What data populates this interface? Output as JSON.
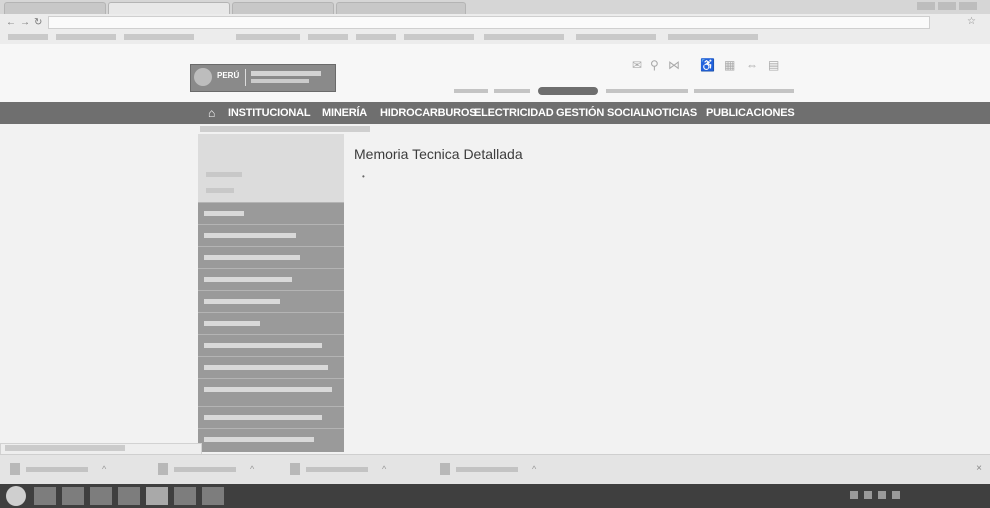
{
  "browser": {
    "tabs": [
      {
        "label": ""
      },
      {
        "label": ""
      },
      {
        "label": ""
      },
      {
        "label": ""
      }
    ],
    "url": "",
    "bookmarks": [
      "",
      "",
      "",
      "",
      "",
      "",
      "",
      "",
      "",
      ""
    ]
  },
  "site": {
    "logo": {
      "country": "PERÚ",
      "name": ""
    },
    "utility_links": [
      "",
      "",
      "",
      ""
    ],
    "utility_pill": "",
    "header_icons": [
      "mail-icon",
      "search-icon",
      "share-icon",
      "accessibility-icon",
      "grid-icon",
      "link-icon",
      "card-icon"
    ]
  },
  "nav": {
    "home_icon": "home-icon",
    "items": [
      {
        "label": "INSTITUCIONAL"
      },
      {
        "label": "MINERÍA"
      },
      {
        "label": "HIDROCARBUROS"
      },
      {
        "label": "ELECTRICIDAD"
      },
      {
        "label": "GESTIÓN SOCIAL"
      },
      {
        "label": "NOTICIAS"
      },
      {
        "label": "PUBLICACIONES"
      }
    ]
  },
  "sidebar": {
    "breadcrumb": "",
    "top_links": [
      "",
      ""
    ],
    "menu_items": [
      "",
      "",
      "",
      "",
      "",
      "",
      "",
      "",
      "",
      "",
      ""
    ]
  },
  "content": {
    "title": "Memoria Tecnica Detallada",
    "doc_link": ""
  },
  "status_bar": {
    "text": ""
  },
  "downloads": {
    "items": [
      {
        "name": ""
      },
      {
        "name": ""
      },
      {
        "name": ""
      },
      {
        "name": ""
      }
    ],
    "show_all": "",
    "close": "×"
  },
  "taskbar": {
    "time": "",
    "date": ""
  }
}
